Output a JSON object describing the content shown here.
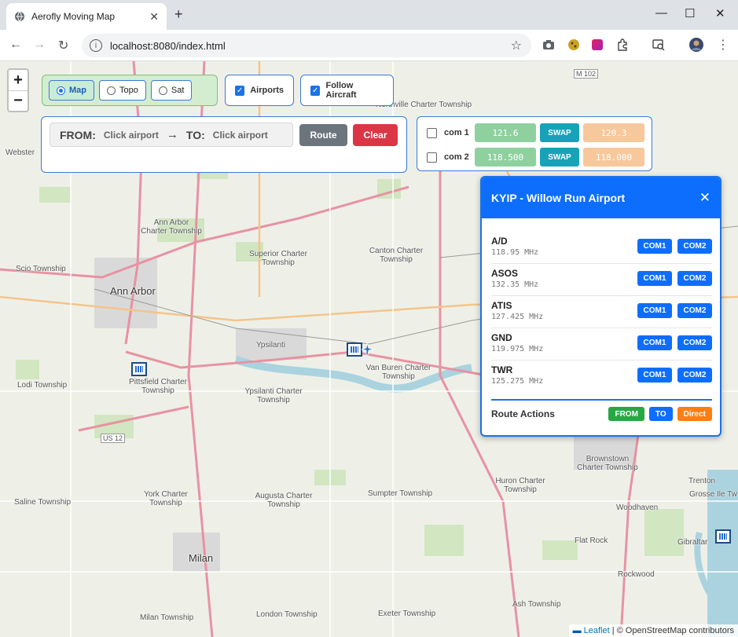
{
  "browser": {
    "tab_title": "Aerofly Moving Map",
    "tab_close": "✕",
    "new_tab": "+",
    "url": "localhost:8080/index.html",
    "minimize": "—",
    "maximize": "☐",
    "close": "✕"
  },
  "map": {
    "zoom_in": "+",
    "zoom_out": "−",
    "labels": [
      {
        "text": "Ann Arbor",
        "big": true
      },
      {
        "text": "Ypsilanti"
      },
      {
        "text": "Ann Arbor Charter Township"
      },
      {
        "text": "Superior Charter Township"
      },
      {
        "text": "Canton Charter Township"
      },
      {
        "text": "Scio Township"
      },
      {
        "text": "Pittsfield Charter Township"
      },
      {
        "text": "Ypsilanti Charter Township"
      },
      {
        "text": "Van Buren Charter Township"
      },
      {
        "text": "Lodi Township"
      },
      {
        "text": "Saline Township"
      },
      {
        "text": "York Charter Township"
      },
      {
        "text": "Augusta Charter Township"
      },
      {
        "text": "Sumpter Township"
      },
      {
        "text": "Huron Charter Township"
      },
      {
        "text": "Brownstown Charter Township"
      },
      {
        "text": "Woodhaven"
      },
      {
        "text": "Trenton"
      },
      {
        "text": "Grosse Ile Tw"
      },
      {
        "text": "Flat Rock"
      },
      {
        "text": "Gibraltar"
      },
      {
        "text": "Rockwood"
      },
      {
        "text": "Ash Township"
      },
      {
        "text": "Milan",
        "big": true
      },
      {
        "text": "Milan Township"
      },
      {
        "text": "London Township"
      },
      {
        "text": "Exeter Township"
      },
      {
        "text": "Webster"
      },
      {
        "text": "Northville Charter Township"
      },
      {
        "text": "M 102"
      },
      {
        "text": "US 12"
      }
    ],
    "attribution_flag": "▬",
    "attribution_link": "Leaflet",
    "attribution_text": "| © OpenStreetMap contributors"
  },
  "layers": {
    "map": "Map",
    "topo": "Topo",
    "sat": "Sat",
    "selected": "Map"
  },
  "toggles": {
    "airports": {
      "label": "Airports",
      "checked": true
    },
    "follow": {
      "label": "Follow Aircraft",
      "checked": true
    }
  },
  "route": {
    "from_label": "FROM:",
    "from_value": "Click airport",
    "arrow": "→",
    "to_label": "TO:",
    "to_value": "Click airport",
    "route_btn": "Route",
    "clear_btn": "Clear"
  },
  "com": {
    "com1": {
      "label": "com 1",
      "active": "121.6",
      "standby": "120.3",
      "swap": "SWAP"
    },
    "com2": {
      "label": "com 2",
      "active": "118.500",
      "standby": "118.000",
      "swap": "SWAP"
    }
  },
  "popup": {
    "title": "KYIP - Willow Run Airport",
    "close": "✕",
    "frequencies": [
      {
        "name": "A/D",
        "mhz": "118.95 MHz"
      },
      {
        "name": "ASOS",
        "mhz": "132.35 MHz"
      },
      {
        "name": "ATIS",
        "mhz": "127.425 MHz"
      },
      {
        "name": "GND",
        "mhz": "119.975 MHz"
      },
      {
        "name": "TWR",
        "mhz": "125.275 MHz"
      }
    ],
    "com1_btn": "COM1",
    "com2_btn": "COM2",
    "route_actions": "Route Actions",
    "from_btn": "FROM",
    "to_btn": "TO",
    "direct_btn": "Direct"
  },
  "colors": {
    "accent": "#0d6efd",
    "route_btn": "#6c757d",
    "clear_btn": "#dc3545",
    "from_btn": "#28a745",
    "direct_btn": "#fd7e14"
  }
}
